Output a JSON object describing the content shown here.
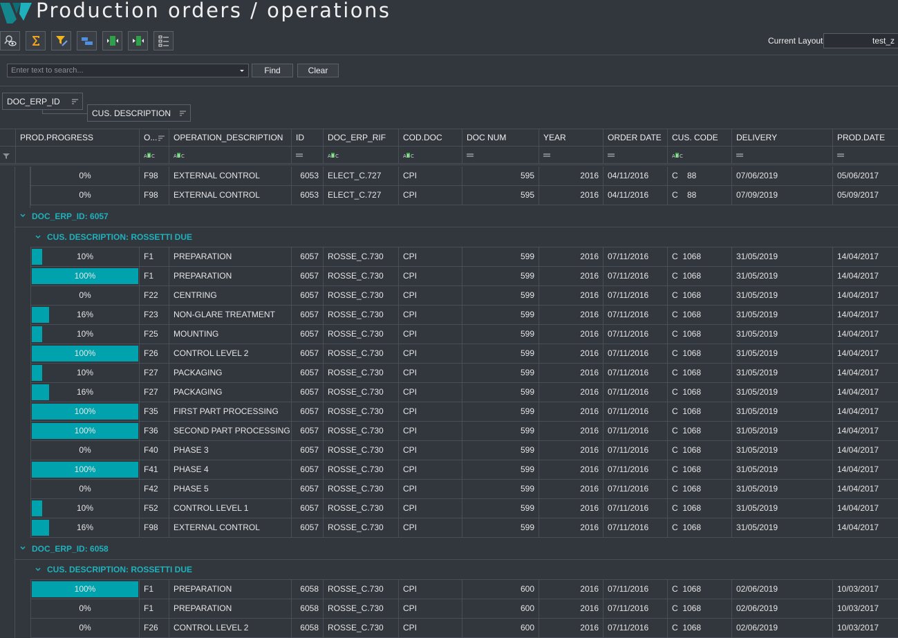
{
  "app": {
    "title": "Production orders / operations"
  },
  "toolbar": {
    "buttons": [
      "find-eye-icon",
      "sum-icon",
      "filter-edit-icon",
      "group-icon",
      "expand-icon",
      "collapse-icon",
      "layout-list-icon"
    ],
    "layout_label": "Current Layout",
    "layout_value": "test_z"
  },
  "search": {
    "placeholder": "Enter text to search...",
    "find_label": "Find",
    "clear_label": "Clear"
  },
  "group_panel": {
    "chips": [
      "DOC_ERP_ID",
      "CUS. DESCRIPTION"
    ]
  },
  "grid": {
    "columns": [
      "PROD.PROGRESS",
      "O...",
      "OPERATION_DESCRIPTION",
      "ID",
      "DOC_ERP_RIF",
      "COD.DOC",
      "DOC NUM",
      "YEAR",
      "ORDER DATE",
      "CUS. CODE",
      "DELIVERY",
      "PROD.DATE"
    ],
    "rows": [
      {
        "kind": "data",
        "progress": 0,
        "pct": "0%",
        "op": "F98",
        "desc": "EXTERNAL CONTROL",
        "id": "6053",
        "rif": "ELECT_C.727",
        "cod": "CPI",
        "num": "595",
        "year": "2016",
        "order": "04/11/2016",
        "cus": "C    88",
        "delivery": "07/06/2019",
        "prod": "05/06/2017"
      },
      {
        "kind": "data",
        "progress": 0,
        "pct": "0%",
        "op": "F98",
        "desc": "EXTERNAL CONTROL",
        "id": "6053",
        "rif": "ELECT_C.727",
        "cod": "CPI",
        "num": "595",
        "year": "2016",
        "order": "04/11/2016",
        "cus": "C    88",
        "delivery": "07/09/2019",
        "prod": "05/09/2017"
      },
      {
        "kind": "group1",
        "label": "DOC_ERP_ID: 6057"
      },
      {
        "kind": "group2",
        "label": "CUS. DESCRIPTION: ROSSETTI DUE"
      },
      {
        "kind": "data",
        "progress": 10,
        "pct": "10%",
        "op": "F1",
        "desc": "PREPARATION",
        "id": "6057",
        "rif": "ROSSE_C.730",
        "cod": "CPI",
        "num": "599",
        "year": "2016",
        "order": "07/11/2016",
        "cus": "C  1068",
        "delivery": "31/05/2019",
        "prod": "14/04/2017"
      },
      {
        "kind": "data",
        "progress": 100,
        "pct": "100%",
        "op": "F1",
        "desc": "PREPARATION",
        "id": "6057",
        "rif": "ROSSE_C.730",
        "cod": "CPI",
        "num": "599",
        "year": "2016",
        "order": "07/11/2016",
        "cus": "C  1068",
        "delivery": "31/05/2019",
        "prod": "14/04/2017"
      },
      {
        "kind": "data",
        "progress": 0,
        "pct": "0%",
        "op": "F22",
        "desc": "CENTRING",
        "id": "6057",
        "rif": "ROSSE_C.730",
        "cod": "CPI",
        "num": "599",
        "year": "2016",
        "order": "07/11/2016",
        "cus": "C  1068",
        "delivery": "31/05/2019",
        "prod": "14/04/2017"
      },
      {
        "kind": "data",
        "progress": 16,
        "pct": "16%",
        "op": "F23",
        "desc": "NON-GLARE TREATMENT",
        "id": "6057",
        "rif": "ROSSE_C.730",
        "cod": "CPI",
        "num": "599",
        "year": "2016",
        "order": "07/11/2016",
        "cus": "C  1068",
        "delivery": "31/05/2019",
        "prod": "14/04/2017"
      },
      {
        "kind": "data",
        "progress": 10,
        "pct": "10%",
        "op": "F25",
        "desc": "MOUNTING",
        "id": "6057",
        "rif": "ROSSE_C.730",
        "cod": "CPI",
        "num": "599",
        "year": "2016",
        "order": "07/11/2016",
        "cus": "C  1068",
        "delivery": "31/05/2019",
        "prod": "14/04/2017"
      },
      {
        "kind": "data",
        "progress": 100,
        "pct": "100%",
        "op": "F26",
        "desc": "CONTROL LEVEL 2",
        "id": "6057",
        "rif": "ROSSE_C.730",
        "cod": "CPI",
        "num": "599",
        "year": "2016",
        "order": "07/11/2016",
        "cus": "C  1068",
        "delivery": "31/05/2019",
        "prod": "14/04/2017"
      },
      {
        "kind": "data",
        "progress": 10,
        "pct": "10%",
        "op": "F27",
        "desc": "PACKAGING",
        "id": "6057",
        "rif": "ROSSE_C.730",
        "cod": "CPI",
        "num": "599",
        "year": "2016",
        "order": "07/11/2016",
        "cus": "C  1068",
        "delivery": "31/05/2019",
        "prod": "14/04/2017"
      },
      {
        "kind": "data",
        "progress": 16,
        "pct": "16%",
        "op": "F27",
        "desc": "PACKAGING",
        "id": "6057",
        "rif": "ROSSE_C.730",
        "cod": "CPI",
        "num": "599",
        "year": "2016",
        "order": "07/11/2016",
        "cus": "C  1068",
        "delivery": "31/05/2019",
        "prod": "14/04/2017"
      },
      {
        "kind": "data",
        "progress": 100,
        "pct": "100%",
        "op": "F35",
        "desc": "FIRST PART PROCESSING",
        "id": "6057",
        "rif": "ROSSE_C.730",
        "cod": "CPI",
        "num": "599",
        "year": "2016",
        "order": "07/11/2016",
        "cus": "C  1068",
        "delivery": "31/05/2019",
        "prod": "14/04/2017"
      },
      {
        "kind": "data",
        "progress": 100,
        "pct": "100%",
        "op": "F36",
        "desc": "SECOND PART PROCESSING",
        "id": "6057",
        "rif": "ROSSE_C.730",
        "cod": "CPI",
        "num": "599",
        "year": "2016",
        "order": "07/11/2016",
        "cus": "C  1068",
        "delivery": "31/05/2019",
        "prod": "14/04/2017"
      },
      {
        "kind": "data",
        "progress": 0,
        "pct": "0%",
        "op": "F40",
        "desc": "PHASE 3",
        "id": "6057",
        "rif": "ROSSE_C.730",
        "cod": "CPI",
        "num": "599",
        "year": "2016",
        "order": "07/11/2016",
        "cus": "C  1068",
        "delivery": "31/05/2019",
        "prod": "14/04/2017"
      },
      {
        "kind": "data",
        "progress": 100,
        "pct": "100%",
        "op": "F41",
        "desc": "PHASE 4",
        "id": "6057",
        "rif": "ROSSE_C.730",
        "cod": "CPI",
        "num": "599",
        "year": "2016",
        "order": "07/11/2016",
        "cus": "C  1068",
        "delivery": "31/05/2019",
        "prod": "14/04/2017"
      },
      {
        "kind": "data",
        "progress": 0,
        "pct": "0%",
        "op": "F42",
        "desc": "PHASE 5",
        "id": "6057",
        "rif": "ROSSE_C.730",
        "cod": "CPI",
        "num": "599",
        "year": "2016",
        "order": "07/11/2016",
        "cus": "C  1068",
        "delivery": "31/05/2019",
        "prod": "14/04/2017"
      },
      {
        "kind": "data",
        "progress": 10,
        "pct": "10%",
        "op": "F52",
        "desc": "CONTROL LEVEL 1",
        "id": "6057",
        "rif": "ROSSE_C.730",
        "cod": "CPI",
        "num": "599",
        "year": "2016",
        "order": "07/11/2016",
        "cus": "C  1068",
        "delivery": "31/05/2019",
        "prod": "14/04/2017"
      },
      {
        "kind": "data",
        "progress": 16,
        "pct": "16%",
        "op": "F98",
        "desc": "EXTERNAL CONTROL",
        "id": "6057",
        "rif": "ROSSE_C.730",
        "cod": "CPI",
        "num": "599",
        "year": "2016",
        "order": "07/11/2016",
        "cus": "C  1068",
        "delivery": "31/05/2019",
        "prod": "14/04/2017"
      },
      {
        "kind": "group1",
        "label": "DOC_ERP_ID: 6058"
      },
      {
        "kind": "group2",
        "label": "CUS. DESCRIPTION: ROSSETTI DUE"
      },
      {
        "kind": "data",
        "progress": 100,
        "pct": "100%",
        "op": "F1",
        "desc": "PREPARATION",
        "id": "6058",
        "rif": "ROSSE_C.730",
        "cod": "CPI",
        "num": "600",
        "year": "2016",
        "order": "07/11/2016",
        "cus": "C  1068",
        "delivery": "02/06/2019",
        "prod": "10/03/2017"
      },
      {
        "kind": "data",
        "progress": 0,
        "pct": "0%",
        "op": "F1",
        "desc": "PREPARATION",
        "id": "6058",
        "rif": "ROSSE_C.730",
        "cod": "CPI",
        "num": "600",
        "year": "2016",
        "order": "07/11/2016",
        "cus": "C  1068",
        "delivery": "02/06/2019",
        "prod": "10/03/2017"
      },
      {
        "kind": "data",
        "progress": 0,
        "pct": "0%",
        "op": "F26",
        "desc": "CONTROL LEVEL 2",
        "id": "6058",
        "rif": "ROSSE_C.730",
        "cod": "CPI",
        "num": "600",
        "year": "2016",
        "order": "07/11/2016",
        "cus": "C  1068",
        "delivery": "02/06/2019",
        "prod": "10/03/2017"
      }
    ]
  },
  "colors": {
    "accent": "#00a3ad",
    "group_text": "#1fb2bd",
    "background": "#32363d"
  }
}
